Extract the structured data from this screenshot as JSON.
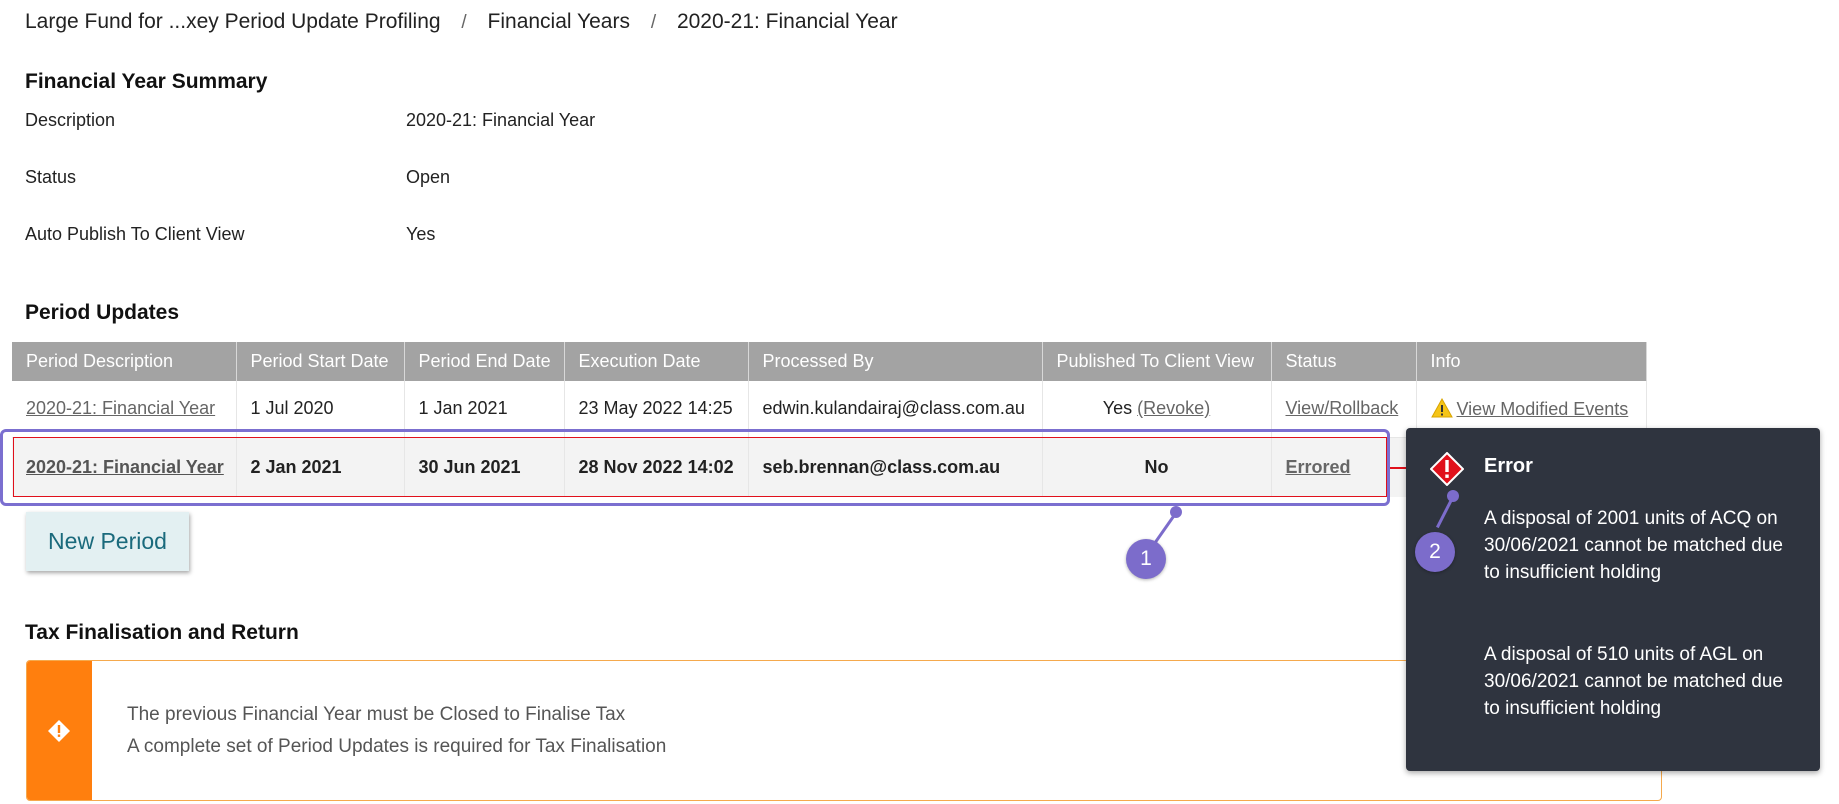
{
  "breadcrumb": {
    "items": [
      "Large Fund for ...xey Period Update Profiling",
      "Financial Years",
      "2020-21: Financial Year"
    ],
    "separator": "/"
  },
  "summary": {
    "title": "Financial Year Summary",
    "fields": [
      {
        "label": "Description",
        "value": "2020-21: Financial Year"
      },
      {
        "label": "Status",
        "value": "Open"
      },
      {
        "label": "Auto Publish To Client View",
        "value": "Yes"
      }
    ]
  },
  "period_updates": {
    "title": "Period Updates",
    "columns": [
      "Period Description",
      "Period Start Date",
      "Period End Date",
      "Execution Date",
      "Processed By",
      "Published To Client View",
      "Status",
      "Info"
    ],
    "rows": [
      {
        "description": "2020-21: Financial Year",
        "start": "1 Jul 2020",
        "end": "1 Jan 2021",
        "execution": "23 May 2022 14:25",
        "processed_by": "edwin.kulandairaj@class.com.au",
        "published": "Yes",
        "revoke": "(Revoke)",
        "status": "View/Rollback",
        "info": "View Modified Events"
      },
      {
        "description": "2020-21: Financial Year",
        "start": "2 Jan 2021",
        "end": "30 Jun 2021",
        "execution": "28 Nov 2022 14:02",
        "processed_by": "seb.brennan@class.com.au",
        "published": "No",
        "status": "Errored"
      }
    ],
    "new_period_label": "New Period"
  },
  "callouts": [
    "1",
    "2"
  ],
  "tax": {
    "title": "Tax Finalisation and Return",
    "lines": [
      "The previous Financial Year must be Closed to Finalise Tax",
      "A complete set of Period Updates is required for Tax Finalisation"
    ]
  },
  "error_tooltip": {
    "title": "Error",
    "messages": [
      "A disposal of 2001 units of ACQ on 30/06/2021 cannot be matched due to insufficient holding",
      "A disposal of 510 units of AGL on 30/06/2021 cannot be matched due to insufficient holding"
    ]
  },
  "colors": {
    "header_bg": "#a3a3a3",
    "error_red": "#e0101b",
    "callout_purple": "#7c6ccb",
    "warning_orange": "#ff7f0e",
    "tooltip_bg": "#2f343f",
    "button_text": "#1a6a7c"
  },
  "icons": {
    "warning": "warning-triangle-icon",
    "error": "error-diamond-icon",
    "tax_warning": "warning-diamond-icon"
  }
}
